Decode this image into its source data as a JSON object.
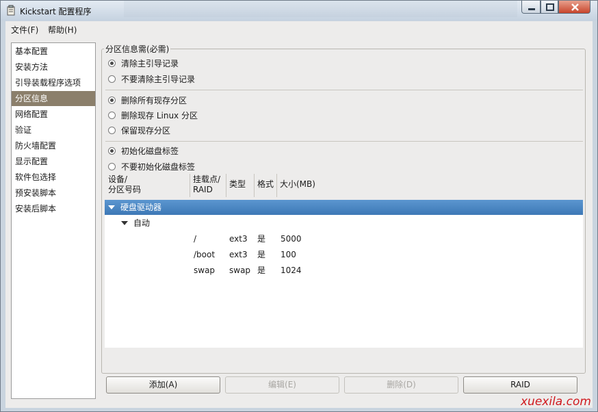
{
  "window": {
    "title": "Kickstart 配置程序"
  },
  "menubar": {
    "file": "文件(F)",
    "help": "帮助(H)"
  },
  "sidebar": {
    "items": [
      {
        "label": "基本配置"
      },
      {
        "label": "安装方法"
      },
      {
        "label": "引导装载程序选项"
      },
      {
        "label": "分区信息"
      },
      {
        "label": "网络配置"
      },
      {
        "label": "验证"
      },
      {
        "label": "防火墙配置"
      },
      {
        "label": "显示配置"
      },
      {
        "label": "软件包选择"
      },
      {
        "label": "预安装脚本"
      },
      {
        "label": "安装后脚本"
      }
    ],
    "selected_index": 3
  },
  "partition": {
    "frame_title": "分区信息需(必需)",
    "mbr_options": [
      {
        "label": "清除主引导记录",
        "checked": true
      },
      {
        "label": "不要清除主引导记录",
        "checked": false
      }
    ],
    "partition_options": [
      {
        "label": "删除所有现存分区",
        "checked": true
      },
      {
        "label": "删除现存 Linux 分区",
        "checked": false
      },
      {
        "label": "保留现存分区",
        "checked": false
      }
    ],
    "label_options": [
      {
        "label": "初始化磁盘标签",
        "checked": true
      },
      {
        "label": "不要初始化磁盘标签",
        "checked": false
      }
    ]
  },
  "table": {
    "headers": [
      "设备/\n分区号码",
      "挂载点/\nRAID",
      "类型",
      "格式",
      "大小(MB)"
    ],
    "root_label": "硬盘驱动器",
    "group_label": "自动",
    "rows": [
      {
        "mount": "/",
        "type": "ext3",
        "format": "是",
        "size": "5000"
      },
      {
        "mount": "/boot",
        "type": "ext3",
        "format": "是",
        "size": "100"
      },
      {
        "mount": "swap",
        "type": "swap",
        "format": "是",
        "size": "1024"
      }
    ]
  },
  "buttons": {
    "add": "添加(A)",
    "edit": "编辑(E)",
    "delete": "删除(D)",
    "raid": "RAID"
  },
  "watermark": "xuexila.com",
  "colors": {
    "selection": "#3d78b6",
    "sidebar_selected": "#8b7f6b",
    "watermark": "#d0191e"
  }
}
